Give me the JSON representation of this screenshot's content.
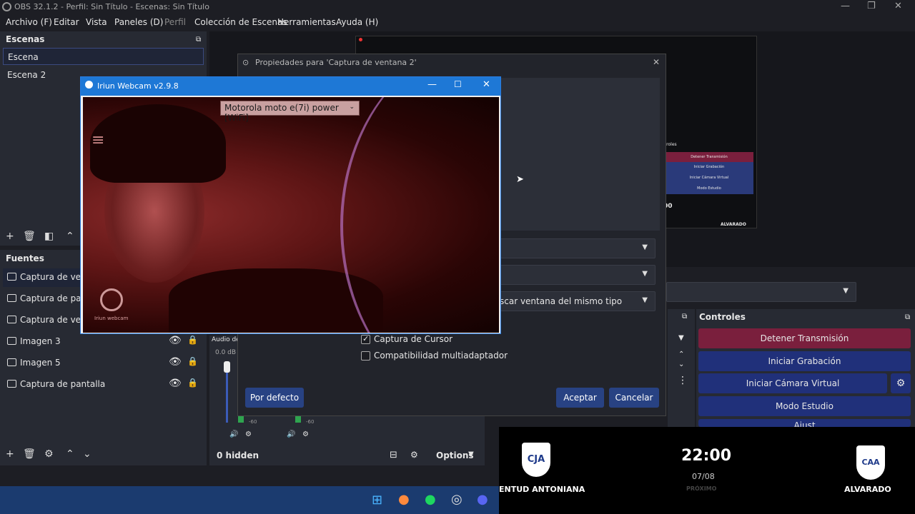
{
  "window": {
    "title": "OBS 32.1.2 - Perfil: Sin Título - Escenas: Sin Título"
  },
  "menu": [
    "Archivo (F)",
    "Editar",
    "Vista",
    "Paneles (D)",
    "Perfil",
    "Colección de Escenas",
    "Herramientas",
    "Ayuda (H)"
  ],
  "scenes": {
    "title": "Escenas",
    "items": [
      "Escena",
      "Escena 2"
    ]
  },
  "sources": {
    "title": "Fuentes",
    "items": [
      "Captura de ventan",
      "Captura de pantall",
      "Captura de ventan",
      "Imagen 3",
      "Imagen 5",
      "Captura de pantalla"
    ],
    "hidden": "0 hidden",
    "options_label": "Options"
  },
  "audio": {
    "label": "Audio de",
    "db": "0.0 dB",
    "scale_a": "-54",
    "scale_b": "-60"
  },
  "properties_dialog": {
    "title": "Propiedades para 'Captura de ventana 2'",
    "priority_value": "scar ventana del mismo tipo",
    "capture_cursor": "Captura de Cursor",
    "multiadapter": "Compatibilidad multiadaptador",
    "defaults_btn": "Por defecto",
    "accept_btn": "Aceptar",
    "cancel_btn": "Cancelar"
  },
  "controls": {
    "title": "Controles",
    "stop_stream": "Detener Transmisión",
    "start_recording": "Iniciar Grabación",
    "start_virtual_cam": "Iniciar Cámara Virtual",
    "studio_mode": "Modo Estudio",
    "next_partial": "Ajust"
  },
  "iriun": {
    "title": "Iriun Webcam v2.9.8",
    "device": "Motorola moto e(7i) power [WiFi]",
    "watermark": "Iriun webcam"
  },
  "nested_preview": {
    "controls_label": "ntroles",
    "btn1": "Detener Transmisión",
    "btn2": "Iniciar Grabación",
    "btn3": "Iniciar Cámara Virtual",
    "btn4": "Modo Estudio",
    "time": "00",
    "team": "ALVARADO"
  },
  "scoreboard": {
    "time": "22:00",
    "date": "07/08",
    "status": "PRÓXIMO",
    "home_team": "ENTUD ANTONIANA",
    "away_team": "ALVARADO",
    "home_crest": "CJA",
    "away_crest": "CAA"
  },
  "colors": {
    "accent_blue": "#284283",
    "stop_red": "#7a1f3d",
    "bg_dark": "#1d1e24",
    "taskbar": "#1b3b6f"
  }
}
